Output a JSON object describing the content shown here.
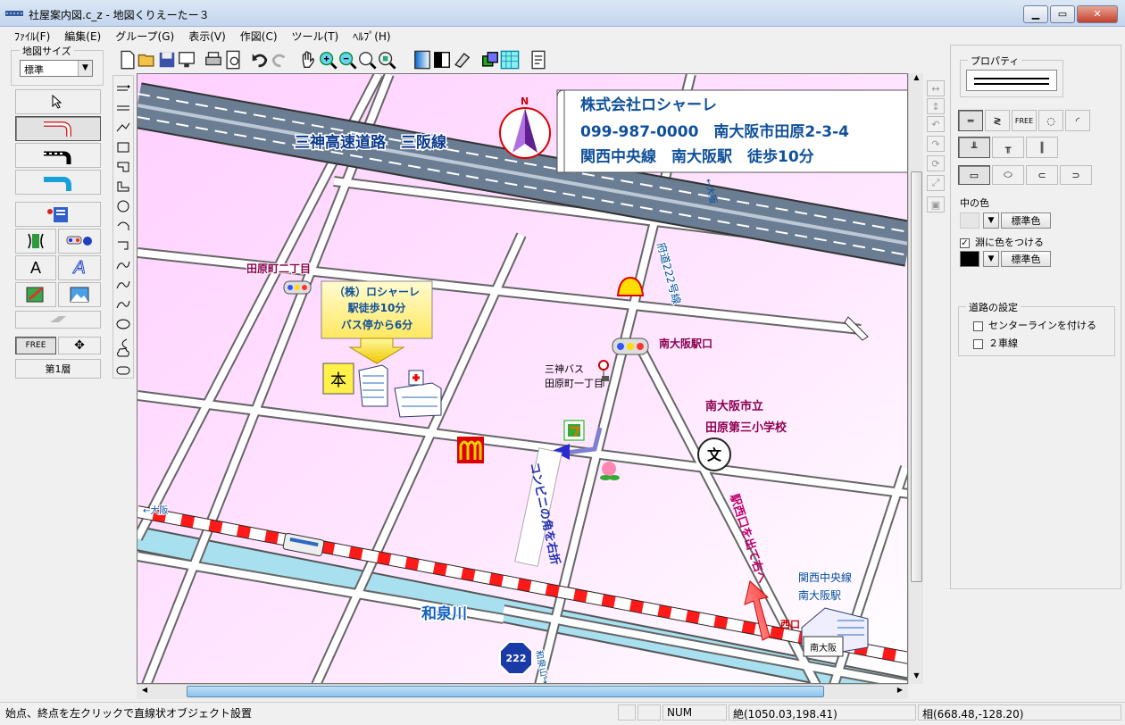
{
  "window": {
    "title": "社屋案内図.c_z - 地図くりえーたー３",
    "controls": [
      "minimize",
      "maximize",
      "close"
    ]
  },
  "menu": [
    "ﾌｧｲﾙ(F)",
    "編集(E)",
    "グループ(G)",
    "表示(V)",
    "作図(C)",
    "ツール(T)",
    "ﾍﾙﾌﾟ(H)"
  ],
  "left_panel": {
    "map_size_label": "地図サイズ",
    "map_size_value": "標準",
    "free_label": "FREE",
    "layer_button": "第1層"
  },
  "map": {
    "company_name": "株式会社ロシャーレ",
    "company_phone_address": "099-987-0000　南大阪市田原2-3-4",
    "company_access": "関西中央線　南大阪駅　徒歩10分",
    "compass_label": "N",
    "highway_name": "三神高速道路　三阪線",
    "callout_lines": [
      "（株）ロシャーレ",
      "駅徒歩10分",
      "バス停から6分"
    ],
    "intersection_tahara2": "田原町二丁目",
    "intersection_minamiosaka": "南大阪駅口",
    "bus_stop_lines": [
      "三神バス",
      "田原町一丁目"
    ],
    "route_sign_prefecture": "府道222号線",
    "direction_osaka_top": "←大阪",
    "direction_osaka_left": "←大阪",
    "direction_izumi": "和泉山→",
    "school_lines": [
      "南大阪市立",
      "田原第三小学校"
    ],
    "school_symbol": "文",
    "headquarters_label": "本",
    "turn_instruction": "コンビニの角を右折",
    "exit_instruction": "駅西口を出て右へ",
    "river_name": "和泉川",
    "station_label_lines": [
      "関西中央線",
      "南大阪駅"
    ],
    "west_exit_label": "西口",
    "station_sign": "南大阪",
    "route_shield_number": "222"
  },
  "properties": {
    "title": "プロパティ",
    "inner_color_label": "中の色",
    "inner_color_button": "標準色",
    "edge_color_checkbox": "淵に色をつける",
    "edge_color_checked": true,
    "edge_color_button": "標準色",
    "road_settings_title": "道路の設定",
    "centerline_checkbox": "センターラインを付ける",
    "centerline_checked": false,
    "two_lane_checkbox": "２車線",
    "two_lane_checked": false
  },
  "status": {
    "message": "始点、終点を左クリックで直線状オブジェクト設置",
    "num": "NUM",
    "absolute": "絶(1050.03,198.41)",
    "relative": "相(668.48,-128.20)"
  },
  "colors": {
    "map_background": "#ffd0ff",
    "road_outline": "#555555",
    "highway_fill": "#6a7d92",
    "railway_red": "#ff1a1a",
    "river_blue": "#a8d8ea",
    "company_text": "#10509a",
    "accent_magenta": "#8b0050"
  }
}
